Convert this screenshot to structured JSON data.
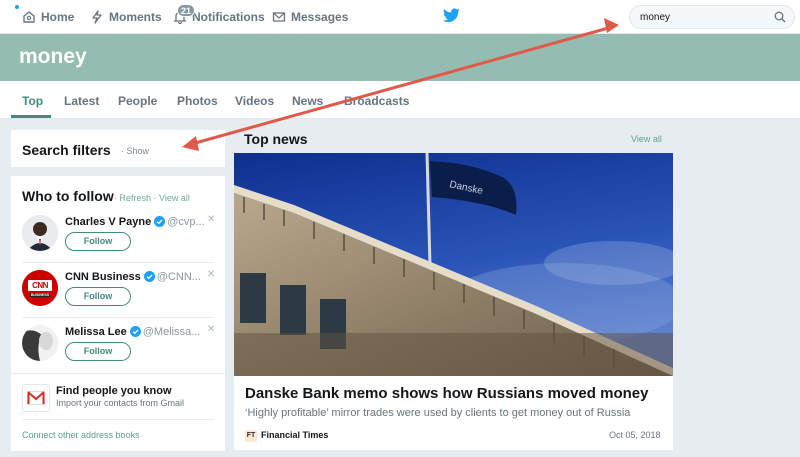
{
  "nav": {
    "home": "Home",
    "moments": "Moments",
    "notifications": "Notifications",
    "notifications_count": "21",
    "messages": "Messages",
    "logo_icon": "twitter-bird-icon"
  },
  "search": {
    "value": "money",
    "icon": "search-icon"
  },
  "header": {
    "title": "money",
    "banner_color": "#95bcb0"
  },
  "tabs": [
    {
      "label": "Top",
      "active": true
    },
    {
      "label": "Latest"
    },
    {
      "label": "People"
    },
    {
      "label": "Photos"
    },
    {
      "label": "Videos"
    },
    {
      "label": "News"
    },
    {
      "label": "Broadcasts"
    }
  ],
  "filters": {
    "title": "Search filters",
    "show_link": "· Show"
  },
  "who_to_follow": {
    "title": "Who to follow",
    "refresh": "· Refresh",
    "view_all": "· View all",
    "people": [
      {
        "name": "Charles V Payne",
        "handle": "@cvp...",
        "follow": "Follow",
        "verified": true
      },
      {
        "name": "CNN Business",
        "handle": "@CNN...",
        "follow": "Follow",
        "verified": true,
        "avatar_text": "CNN",
        "avatar_subtext": "BUSINESS"
      },
      {
        "name": "Melissa Lee",
        "handle": "@Melissa...",
        "follow": "Follow",
        "verified": true
      }
    ],
    "find_people_title": "Find people you know",
    "find_people_sub": "Import your contacts from Gmail",
    "connect_link": "Connect other address books"
  },
  "top_news": {
    "title": "Top news",
    "view_all": "View all",
    "headline": "Danske Bank memo shows how Russians moved money",
    "description": "‘Highly profitable’ mirror trades were used by clients to get money out of Russia",
    "source_icon": "FT",
    "source": "Financial Times",
    "date": "Oct 05, 2018",
    "image_flag_text": "Danske"
  },
  "colors": {
    "accent": "#43897d",
    "twitter_blue": "#1da1f2",
    "annotation_arrow": "#e05a4a"
  }
}
